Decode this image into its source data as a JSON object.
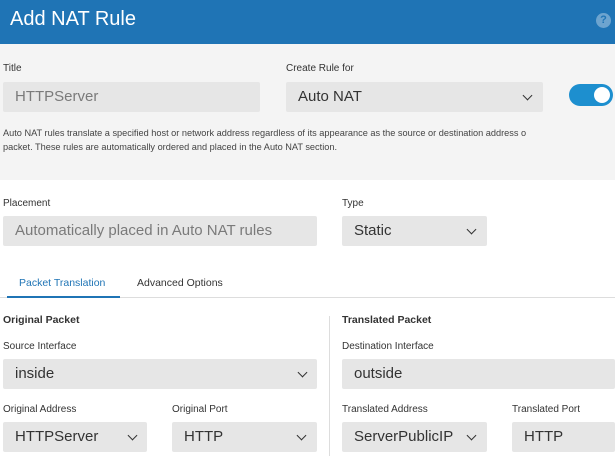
{
  "header": {
    "title": "Add NAT Rule",
    "help_icon": "?"
  },
  "title_field": {
    "label": "Title",
    "value": "HTTPServer"
  },
  "create_rule": {
    "label": "Create Rule for",
    "value": "Auto NAT",
    "enabled": true
  },
  "description": [
    "Auto NAT rules translate a specified host or network address regardless of its appearance as the source or destination address o",
    "packet. These rules are automatically ordered and placed in the Auto NAT section."
  ],
  "placement": {
    "label": "Placement",
    "value": "Automatically placed in Auto NAT rules"
  },
  "type": {
    "label": "Type",
    "value": "Static"
  },
  "tabs": [
    {
      "label": "Packet Translation",
      "active": true
    },
    {
      "label": "Advanced Options",
      "active": false
    }
  ],
  "original_packet": {
    "title": "Original Packet",
    "source_interface": {
      "label": "Source Interface",
      "value": "inside"
    },
    "original_address": {
      "label": "Original Address",
      "value": "HTTPServer"
    },
    "original_port": {
      "label": "Original Port",
      "value": "HTTP"
    }
  },
  "translated_packet": {
    "title": "Translated Packet",
    "destination_interface": {
      "label": "Destination Interface",
      "value": "outside"
    },
    "translated_address": {
      "label": "Translated Address",
      "value": "ServerPublicIP"
    },
    "translated_port": {
      "label": "Translated Port",
      "value": "HTTP"
    }
  },
  "colors": {
    "header": "#1f74b5",
    "accent": "#1d8fcf",
    "field_bg": "#e6e6e6",
    "section_bg": "#f4f4f4"
  }
}
